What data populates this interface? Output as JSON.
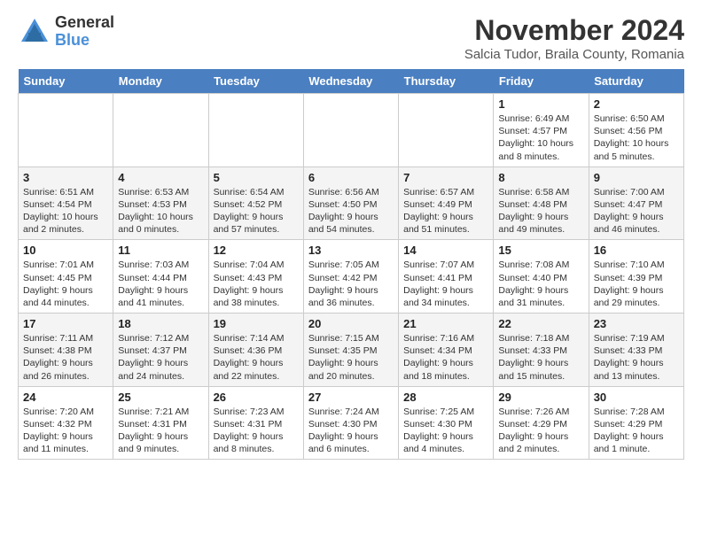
{
  "header": {
    "logo_line1": "General",
    "logo_line2": "Blue",
    "title": "November 2024",
    "subtitle": "Salcia Tudor, Braila County, Romania"
  },
  "days_of_week": [
    "Sunday",
    "Monday",
    "Tuesday",
    "Wednesday",
    "Thursday",
    "Friday",
    "Saturday"
  ],
  "weeks": [
    [
      {
        "day": "",
        "info": ""
      },
      {
        "day": "",
        "info": ""
      },
      {
        "day": "",
        "info": ""
      },
      {
        "day": "",
        "info": ""
      },
      {
        "day": "",
        "info": ""
      },
      {
        "day": "1",
        "info": "Sunrise: 6:49 AM\nSunset: 4:57 PM\nDaylight: 10 hours and 8 minutes."
      },
      {
        "day": "2",
        "info": "Sunrise: 6:50 AM\nSunset: 4:56 PM\nDaylight: 10 hours and 5 minutes."
      }
    ],
    [
      {
        "day": "3",
        "info": "Sunrise: 6:51 AM\nSunset: 4:54 PM\nDaylight: 10 hours and 2 minutes."
      },
      {
        "day": "4",
        "info": "Sunrise: 6:53 AM\nSunset: 4:53 PM\nDaylight: 10 hours and 0 minutes."
      },
      {
        "day": "5",
        "info": "Sunrise: 6:54 AM\nSunset: 4:52 PM\nDaylight: 9 hours and 57 minutes."
      },
      {
        "day": "6",
        "info": "Sunrise: 6:56 AM\nSunset: 4:50 PM\nDaylight: 9 hours and 54 minutes."
      },
      {
        "day": "7",
        "info": "Sunrise: 6:57 AM\nSunset: 4:49 PM\nDaylight: 9 hours and 51 minutes."
      },
      {
        "day": "8",
        "info": "Sunrise: 6:58 AM\nSunset: 4:48 PM\nDaylight: 9 hours and 49 minutes."
      },
      {
        "day": "9",
        "info": "Sunrise: 7:00 AM\nSunset: 4:47 PM\nDaylight: 9 hours and 46 minutes."
      }
    ],
    [
      {
        "day": "10",
        "info": "Sunrise: 7:01 AM\nSunset: 4:45 PM\nDaylight: 9 hours and 44 minutes."
      },
      {
        "day": "11",
        "info": "Sunrise: 7:03 AM\nSunset: 4:44 PM\nDaylight: 9 hours and 41 minutes."
      },
      {
        "day": "12",
        "info": "Sunrise: 7:04 AM\nSunset: 4:43 PM\nDaylight: 9 hours and 38 minutes."
      },
      {
        "day": "13",
        "info": "Sunrise: 7:05 AM\nSunset: 4:42 PM\nDaylight: 9 hours and 36 minutes."
      },
      {
        "day": "14",
        "info": "Sunrise: 7:07 AM\nSunset: 4:41 PM\nDaylight: 9 hours and 34 minutes."
      },
      {
        "day": "15",
        "info": "Sunrise: 7:08 AM\nSunset: 4:40 PM\nDaylight: 9 hours and 31 minutes."
      },
      {
        "day": "16",
        "info": "Sunrise: 7:10 AM\nSunset: 4:39 PM\nDaylight: 9 hours and 29 minutes."
      }
    ],
    [
      {
        "day": "17",
        "info": "Sunrise: 7:11 AM\nSunset: 4:38 PM\nDaylight: 9 hours and 26 minutes."
      },
      {
        "day": "18",
        "info": "Sunrise: 7:12 AM\nSunset: 4:37 PM\nDaylight: 9 hours and 24 minutes."
      },
      {
        "day": "19",
        "info": "Sunrise: 7:14 AM\nSunset: 4:36 PM\nDaylight: 9 hours and 22 minutes."
      },
      {
        "day": "20",
        "info": "Sunrise: 7:15 AM\nSunset: 4:35 PM\nDaylight: 9 hours and 20 minutes."
      },
      {
        "day": "21",
        "info": "Sunrise: 7:16 AM\nSunset: 4:34 PM\nDaylight: 9 hours and 18 minutes."
      },
      {
        "day": "22",
        "info": "Sunrise: 7:18 AM\nSunset: 4:33 PM\nDaylight: 9 hours and 15 minutes."
      },
      {
        "day": "23",
        "info": "Sunrise: 7:19 AM\nSunset: 4:33 PM\nDaylight: 9 hours and 13 minutes."
      }
    ],
    [
      {
        "day": "24",
        "info": "Sunrise: 7:20 AM\nSunset: 4:32 PM\nDaylight: 9 hours and 11 minutes."
      },
      {
        "day": "25",
        "info": "Sunrise: 7:21 AM\nSunset: 4:31 PM\nDaylight: 9 hours and 9 minutes."
      },
      {
        "day": "26",
        "info": "Sunrise: 7:23 AM\nSunset: 4:31 PM\nDaylight: 9 hours and 8 minutes."
      },
      {
        "day": "27",
        "info": "Sunrise: 7:24 AM\nSunset: 4:30 PM\nDaylight: 9 hours and 6 minutes."
      },
      {
        "day": "28",
        "info": "Sunrise: 7:25 AM\nSunset: 4:30 PM\nDaylight: 9 hours and 4 minutes."
      },
      {
        "day": "29",
        "info": "Sunrise: 7:26 AM\nSunset: 4:29 PM\nDaylight: 9 hours and 2 minutes."
      },
      {
        "day": "30",
        "info": "Sunrise: 7:28 AM\nSunset: 4:29 PM\nDaylight: 9 hours and 1 minute."
      }
    ]
  ]
}
